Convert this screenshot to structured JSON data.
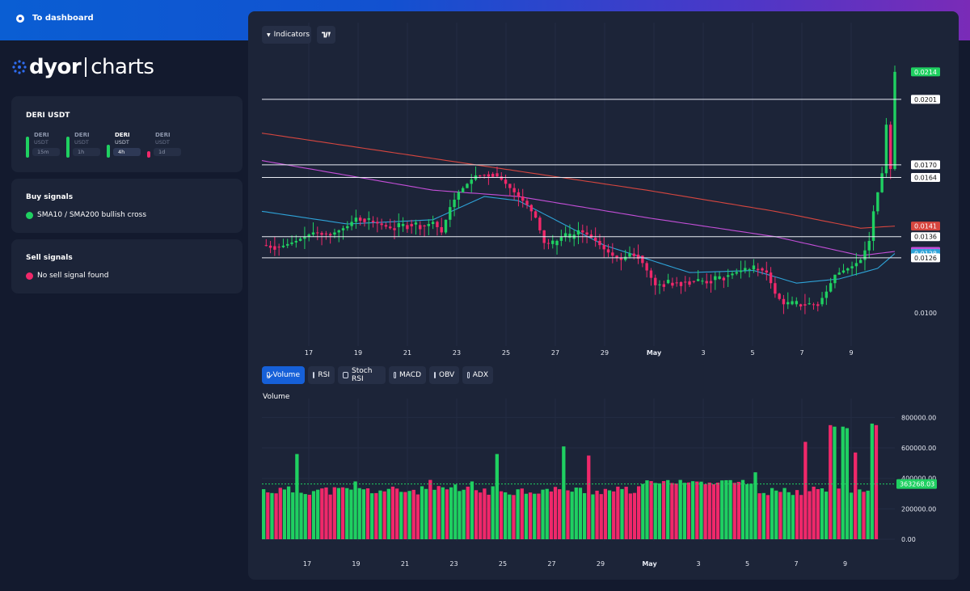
{
  "header": {
    "back_label": "To dashboard"
  },
  "logo": {
    "brand": "dyor",
    "product": "charts"
  },
  "pair_card": {
    "title": "DERI USDT",
    "timeframes": [
      {
        "symbol": "DERI",
        "quote": "USDT",
        "interval": "15m",
        "trend": "up",
        "active": false
      },
      {
        "symbol": "DERI",
        "quote": "USDT",
        "interval": "1h",
        "trend": "up",
        "active": false
      },
      {
        "symbol": "DERI",
        "quote": "USDT",
        "interval": "4h",
        "trend": "up",
        "active": true
      },
      {
        "symbol": "DERI",
        "quote": "USDT",
        "interval": "1d",
        "trend": "down",
        "active": false
      }
    ]
  },
  "buy_signals": {
    "title": "Buy signals",
    "items": [
      "SMA10 / SMA200 bullish cross"
    ]
  },
  "sell_signals": {
    "title": "Sell signals",
    "items": [
      "No sell signal found"
    ]
  },
  "toolbar": {
    "indicators_label": "Indicators"
  },
  "indicator_toggles": [
    {
      "label": "Volume",
      "checked": true
    },
    {
      "label": "RSI",
      "checked": false
    },
    {
      "label": "Stoch RSI",
      "checked": false
    },
    {
      "label": "MACD",
      "checked": false
    },
    {
      "label": "OBV",
      "checked": false
    },
    {
      "label": "ADX",
      "checked": false
    }
  ],
  "volume_panel": {
    "title": "Volume"
  },
  "colors": {
    "up": "#1fd061",
    "down": "#f0286a",
    "sma_long": "#d6463f",
    "sma_mid": "#c44fd8",
    "sma_short": "#2ea3d8",
    "accent": "#1660d8"
  },
  "chart_data": [
    {
      "type": "candlestick",
      "x_ticks": [
        "17",
        "19",
        "21",
        "23",
        "25",
        "27",
        "29",
        "May",
        "3",
        "5",
        "7",
        "9"
      ],
      "y_range": [
        0.0085,
        0.0235
      ],
      "y_labels": [
        "0.0214",
        "0.0201",
        "0.0170",
        "0.0164",
        "0.0141",
        "0.0136",
        "0.0129",
        "0.0128",
        "0.0126",
        "0.0100"
      ],
      "price_lines": [
        0.0201,
        0.017,
        0.0164,
        0.0136,
        0.0126
      ],
      "last_price": 0.0214,
      "sma_values": {
        "sma_long": 0.0141,
        "sma_mid": 0.0129,
        "sma_short": 0.0128
      },
      "path_points": [
        [
          0,
          0.0132
        ],
        [
          4,
          0.0131
        ],
        [
          8,
          0.0134
        ],
        [
          12,
          0.0138
        ],
        [
          16,
          0.0137
        ],
        [
          20,
          0.0141
        ],
        [
          22,
          0.0145
        ],
        [
          26,
          0.0143
        ],
        [
          30,
          0.014
        ],
        [
          34,
          0.0142
        ],
        [
          38,
          0.0141
        ],
        [
          40,
          0.0143
        ],
        [
          42,
          0.0138
        ],
        [
          44,
          0.015
        ],
        [
          46,
          0.0157
        ],
        [
          48,
          0.0161
        ],
        [
          50,
          0.0165
        ],
        [
          54,
          0.0166
        ],
        [
          56,
          0.0163
        ],
        [
          60,
          0.0155
        ],
        [
          62,
          0.0151
        ],
        [
          64,
          0.0145
        ],
        [
          66,
          0.0133
        ],
        [
          68,
          0.0132
        ],
        [
          70,
          0.0136
        ],
        [
          72,
          0.0135
        ],
        [
          74,
          0.0139
        ],
        [
          76,
          0.0137
        ],
        [
          78,
          0.0134
        ],
        [
          80,
          0.013
        ],
        [
          82,
          0.0127
        ],
        [
          84,
          0.0125
        ],
        [
          86,
          0.0128
        ],
        [
          88,
          0.0127
        ],
        [
          90,
          0.012
        ],
        [
          92,
          0.0113
        ],
        [
          94,
          0.0114
        ],
        [
          100,
          0.0115
        ],
        [
          104,
          0.0115
        ],
        [
          108,
          0.0117
        ],
        [
          112,
          0.012
        ],
        [
          116,
          0.0121
        ],
        [
          118,
          0.0119
        ],
        [
          120,
          0.0109
        ],
        [
          122,
          0.0104
        ],
        [
          126,
          0.0104
        ],
        [
          130,
          0.0104
        ],
        [
          132,
          0.011
        ],
        [
          134,
          0.0118
        ],
        [
          136,
          0.012
        ],
        [
          138,
          0.0122
        ],
        [
          140,
          0.0125
        ],
        [
          142,
          0.0134
        ],
        [
          143,
          0.0148
        ],
        [
          144,
          0.0157
        ],
        [
          145,
          0.0166
        ],
        [
          146,
          0.0189
        ],
        [
          147,
          0.0168
        ],
        [
          148,
          0.0214
        ]
      ],
      "sma_long_points": [
        [
          0,
          0.0185
        ],
        [
          30,
          0.0176
        ],
        [
          60,
          0.0167
        ],
        [
          90,
          0.0158
        ],
        [
          120,
          0.0148
        ],
        [
          140,
          0.014
        ],
        [
          148,
          0.0141
        ]
      ],
      "sma_mid_points": [
        [
          0,
          0.0172
        ],
        [
          20,
          0.0165
        ],
        [
          40,
          0.0158
        ],
        [
          60,
          0.0155
        ],
        [
          90,
          0.0145
        ],
        [
          120,
          0.0136
        ],
        [
          140,
          0.0127
        ],
        [
          148,
          0.0129
        ]
      ],
      "sma_short_points": [
        [
          0,
          0.0148
        ],
        [
          20,
          0.0142
        ],
        [
          40,
          0.0144
        ],
        [
          52,
          0.0155
        ],
        [
          60,
          0.0153
        ],
        [
          80,
          0.0132
        ],
        [
          100,
          0.0119
        ],
        [
          115,
          0.012
        ],
        [
          125,
          0.0114
        ],
        [
          135,
          0.0116
        ],
        [
          144,
          0.0121
        ],
        [
          148,
          0.0128
        ]
      ]
    },
    {
      "type": "bar",
      "series": [
        {
          "name": "Volume"
        }
      ],
      "y_range": [
        0,
        850000
      ],
      "y_ticks": [
        0,
        200000,
        400000,
        600000,
        800000
      ],
      "y_tick_labels": [
        "0.00",
        "200000.00",
        "400000.00",
        "600000.00",
        "800000.00"
      ],
      "last_volume_label": "363268.03",
      "last_volume": 363268.03,
      "x_ticks": [
        "17",
        "19",
        "21",
        "23",
        "25",
        "27",
        "29",
        "May",
        "3",
        "5",
        "7",
        "9"
      ]
    }
  ]
}
